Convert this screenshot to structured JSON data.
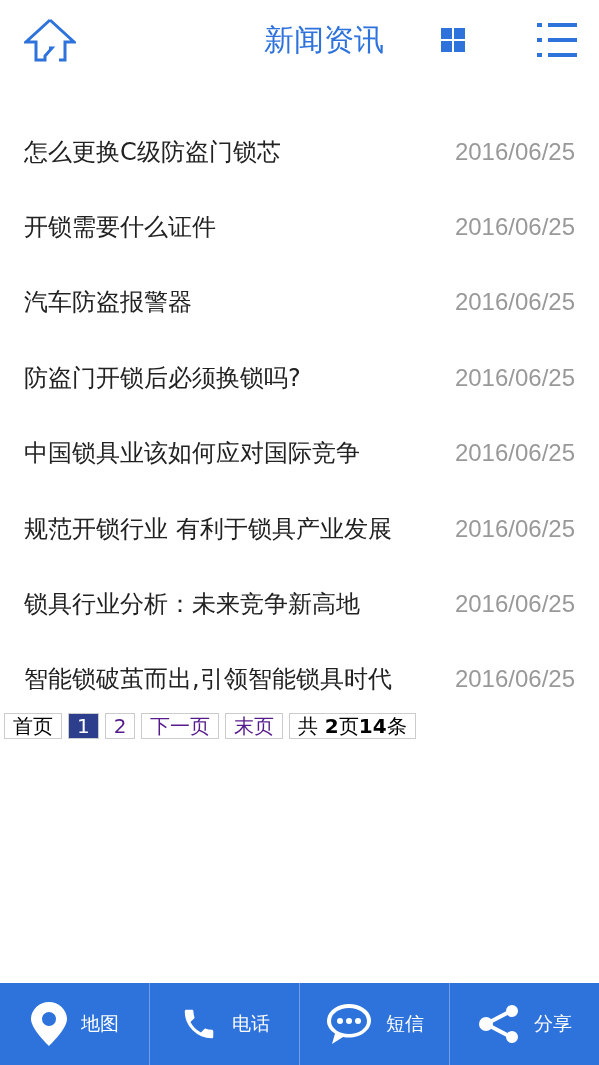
{
  "header": {
    "title": "新闻资讯"
  },
  "news": [
    {
      "title": "怎么更换C级防盗门锁芯",
      "date": "2016/06/25"
    },
    {
      "title": "开锁需要什么证件",
      "date": "2016/06/25"
    },
    {
      "title": "汽车防盗报警器",
      "date": "2016/06/25"
    },
    {
      "title": "防盗门开锁后必须换锁吗?",
      "date": "2016/06/25"
    },
    {
      "title": "中国锁具业该如何应对国际竞争",
      "date": "2016/06/25"
    },
    {
      "title": "规范开锁行业 有利于锁具产业发展",
      "date": "2016/06/25"
    },
    {
      "title": "锁具行业分析：未来竞争新高地",
      "date": "2016/06/25"
    },
    {
      "title": "智能锁破茧而出,引领智能锁具时代",
      "date": "2016/06/25"
    }
  ],
  "pagination": [
    {
      "kind": "link",
      "label": "首页",
      "visited": false
    },
    {
      "kind": "page",
      "label": "1",
      "selected": true
    },
    {
      "kind": "page",
      "label": "2",
      "selected": false
    },
    {
      "kind": "link",
      "label": "下一页",
      "visited": true
    },
    {
      "kind": "link",
      "label": "末页",
      "visited": true
    },
    {
      "kind": "info",
      "label": "共 **2**页**14**条"
    }
  ],
  "bottom_bar": [
    {
      "kind": "map",
      "label": "地图"
    },
    {
      "kind": "phone",
      "label": "电话"
    },
    {
      "kind": "sms",
      "label": "短信"
    },
    {
      "kind": "share",
      "label": "分享"
    }
  ]
}
